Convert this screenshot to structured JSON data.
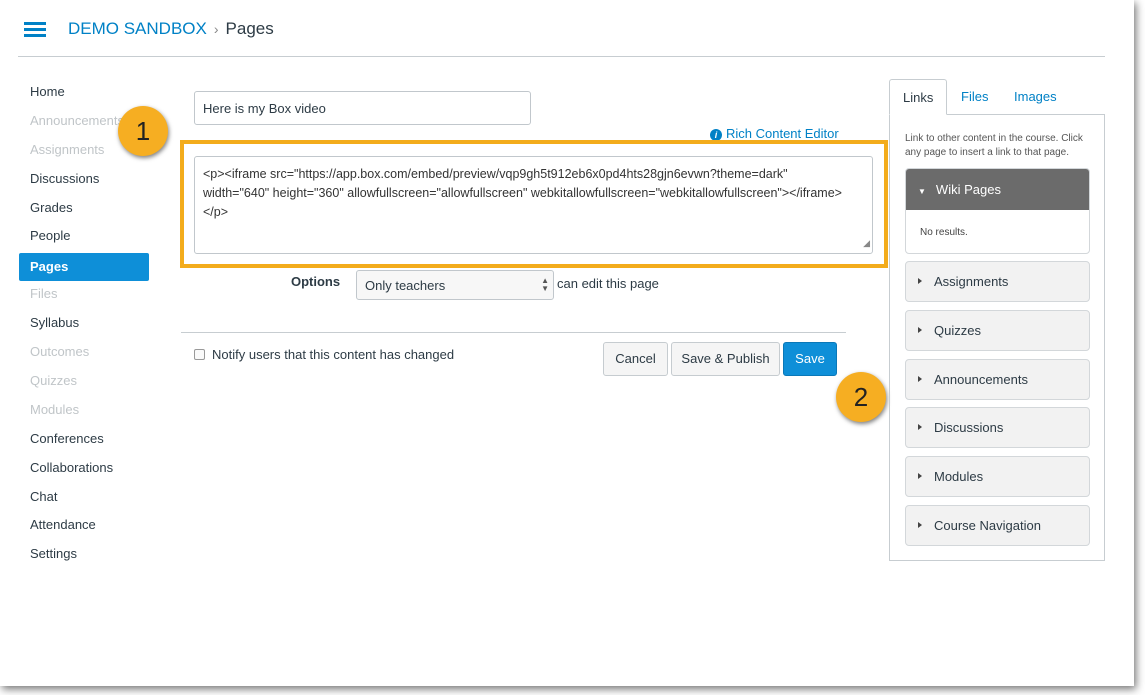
{
  "header": {
    "breadcrumb": [
      "DEMO SANDBOX",
      "Pages"
    ],
    "separator": "›"
  },
  "sidebar": {
    "items": [
      {
        "label": "Home",
        "state": "enabled"
      },
      {
        "label": "Announcements",
        "state": "disabled"
      },
      {
        "label": "Assignments",
        "state": "disabled"
      },
      {
        "label": "Discussions",
        "state": "enabled"
      },
      {
        "label": "Grades",
        "state": "enabled"
      },
      {
        "label": "People",
        "state": "enabled"
      },
      {
        "label": "Pages",
        "state": "active"
      },
      {
        "label": "Files",
        "state": "disabled"
      },
      {
        "label": "Syllabus",
        "state": "enabled"
      },
      {
        "label": "Outcomes",
        "state": "disabled"
      },
      {
        "label": "Quizzes",
        "state": "disabled"
      },
      {
        "label": "Modules",
        "state": "disabled"
      },
      {
        "label": "Conferences",
        "state": "enabled"
      },
      {
        "label": "Collaborations",
        "state": "enabled"
      },
      {
        "label": "Chat",
        "state": "enabled"
      },
      {
        "label": "Attendance",
        "state": "enabled"
      },
      {
        "label": "Settings",
        "state": "enabled"
      }
    ]
  },
  "editor": {
    "title_value": "Here is my Box video",
    "rce_link": "Rich Content Editor",
    "rce_icon": "info-icon",
    "html_lines": [
      "<p><iframe src=\"https://app.box.com/embed/preview/vqp9gh5t912eb6x0pd4hts28gjn6evwn?theme=dark\"",
      "width=\"640\" height=\"360\" allowfullscreen=\"allowfullscreen\" webkitallowfullscreen=\"webkitallowfullscreen\"></iframe>",
      "</p>"
    ],
    "options_label": "Options",
    "options_value": "Only teachers",
    "options_suffix": "can edit this page",
    "notify_label": "Notify users that this content has changed",
    "notify_checked": false,
    "cancel": "Cancel",
    "save_publish": "Save & Publish",
    "save": "Save"
  },
  "callouts": {
    "one": "1",
    "two": "2",
    "color": "#f6ae22"
  },
  "right_panel": {
    "tabs": [
      "Links",
      "Files",
      "Images"
    ],
    "active_tab": "Links",
    "description": "Link to other content in the course. Click any page to insert a link to that page.",
    "wiki_pages": "Wiki Pages",
    "no_results": "No results.",
    "sections": [
      "Assignments",
      "Quizzes",
      "Announcements",
      "Discussions",
      "Modules",
      "Course Navigation"
    ]
  },
  "colors": {
    "accent": "#0081c6",
    "highlight": "#f3ac1c",
    "save": "#0e8fd8"
  }
}
